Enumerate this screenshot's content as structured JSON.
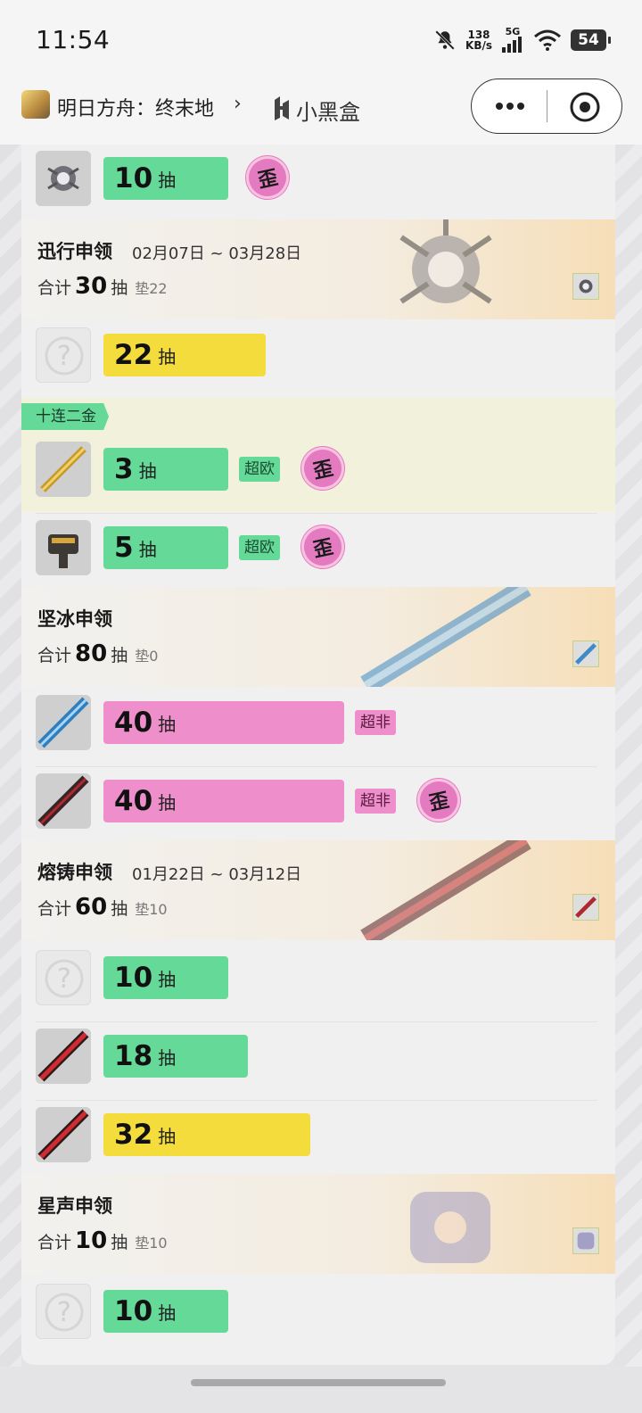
{
  "status_bar": {
    "time": "11:54",
    "net_speed_value": "138",
    "net_speed_unit": "KB/s",
    "network": "5G",
    "battery": "54",
    "icons": [
      "bell-off-icon",
      "signal-icon",
      "wifi-icon",
      "battery-icon"
    ]
  },
  "nav": {
    "app_name": "明日方舟：终末地",
    "chevron": "›",
    "brand_name": "小黑盒"
  },
  "unit": "抽",
  "labels": {
    "total": "合计",
    "unknown": "?"
  },
  "colors": {
    "green": "#64d998",
    "yellow": "#f4dc3d",
    "pink": "#ee8fcb",
    "card_bg": "#f0f0f0"
  },
  "rows": [
    {
      "count": "10",
      "bar_color": "green",
      "stamp": "歪",
      "tag": ""
    },
    {
      "count": "22",
      "bar_color": "yellow",
      "stamp": "",
      "tag": ""
    },
    {
      "count": "3",
      "bar_color": "green",
      "tag": "超欧",
      "stamp": "歪"
    },
    {
      "count": "5",
      "bar_color": "green",
      "tag": "超欧",
      "stamp": "歪"
    },
    {
      "count": "40",
      "bar_color": "pink",
      "tag": "超非",
      "stamp": ""
    },
    {
      "count": "40",
      "bar_color": "pink",
      "tag": "超非",
      "stamp": "歪"
    },
    {
      "count": "10",
      "bar_color": "green",
      "tag": "",
      "stamp": ""
    },
    {
      "count": "18",
      "bar_color": "green",
      "tag": "",
      "stamp": ""
    },
    {
      "count": "32",
      "bar_color": "yellow",
      "tag": "",
      "stamp": ""
    },
    {
      "count": "10",
      "bar_color": "green",
      "tag": "",
      "stamp": ""
    }
  ],
  "pools": [
    {
      "name": "迅行申领",
      "date": "02月07日 ~ 03月28日",
      "total": "30",
      "pad": "垫22"
    },
    {
      "name": "坚冰申领",
      "date": "",
      "total": "80",
      "pad": "垫0"
    },
    {
      "name": "熔铸申领",
      "date": "01月22日 ~ 03月12日",
      "total": "60",
      "pad": "垫10"
    },
    {
      "name": "星声申领",
      "date": "",
      "total": "10",
      "pad": "垫10"
    }
  ],
  "ribbon": "十连二金"
}
